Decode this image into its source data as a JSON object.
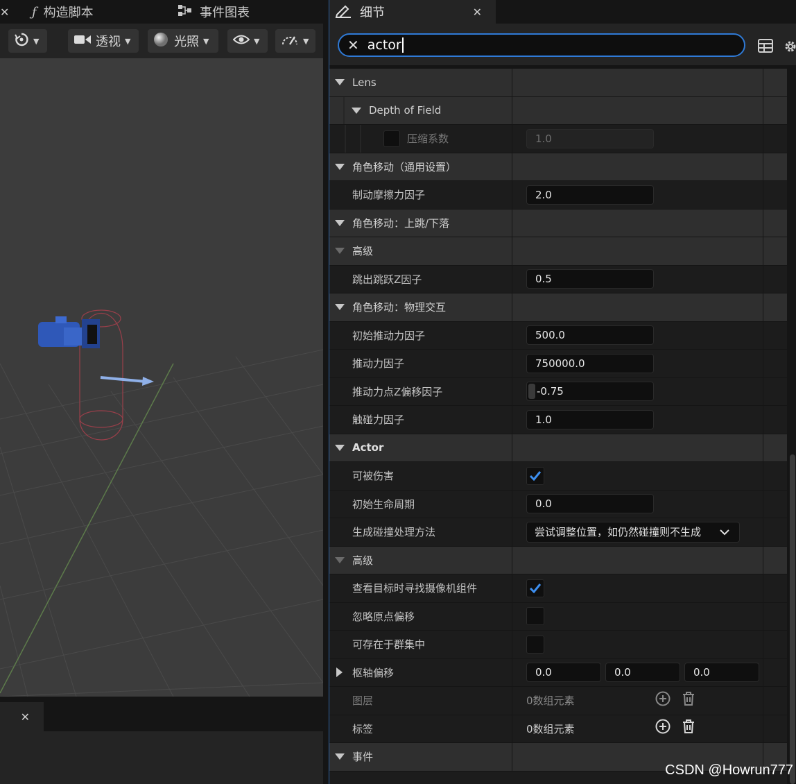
{
  "left_tabs": {
    "close": "✕",
    "construction_script_icon": "ƒ",
    "construction_script": "构造脚本",
    "event_graph": "事件图表"
  },
  "viewport_toolbar": {
    "view_mode": "透视",
    "lighting": "光照"
  },
  "bottom_tab": {
    "close": "✕"
  },
  "details": {
    "tab_title": "细节",
    "tab_close": "✕",
    "search_value": "actor",
    "rows": [
      {
        "kind": "cat",
        "label": "Lens"
      },
      {
        "kind": "cat",
        "label": "Depth of Field",
        "indent": 1
      },
      {
        "kind": "prop",
        "label": "压缩系数",
        "value": "1.0",
        "dim": true,
        "checkbox_prefix": true
      },
      {
        "kind": "cat",
        "label": "角色移动（通用设置）"
      },
      {
        "kind": "prop",
        "label": "制动摩擦力因子",
        "value": "2.0"
      },
      {
        "kind": "cat",
        "label": "角色移动：上跳/下落"
      },
      {
        "kind": "cat",
        "label": "高级",
        "dim_arrow": true
      },
      {
        "kind": "prop",
        "label": "跳出跳跃Z因子",
        "value": "0.5"
      },
      {
        "kind": "cat",
        "label": "角色移动：物理交互"
      },
      {
        "kind": "prop",
        "label": "初始推动力因子",
        "value": "500.0"
      },
      {
        "kind": "prop",
        "label": "推动力因子",
        "value": "750000.0"
      },
      {
        "kind": "prop",
        "label": "推动力点Z偏移因子",
        "value": "-0.75",
        "slider": true
      },
      {
        "kind": "prop",
        "label": "触碰力因子",
        "value": "1.0"
      },
      {
        "kind": "cat",
        "label": "Actor",
        "bold": true
      },
      {
        "kind": "check",
        "label": "可被伤害",
        "checked": true
      },
      {
        "kind": "prop",
        "label": "初始生命周期",
        "value": "0.0"
      },
      {
        "kind": "dropdown",
        "label": "生成碰撞处理方法",
        "value": "尝试调整位置，如仍然碰撞则不生成"
      },
      {
        "kind": "cat",
        "label": "高级",
        "dim_arrow": true
      },
      {
        "kind": "check",
        "label": "查看目标时寻找摄像机组件",
        "checked": true
      },
      {
        "kind": "check",
        "label": "忽略原点偏移",
        "checked": false
      },
      {
        "kind": "check",
        "label": "可存在于群集中",
        "checked": false
      },
      {
        "kind": "vector",
        "label": "枢轴偏移",
        "values": [
          "0.0",
          "0.0",
          "0.0"
        ]
      },
      {
        "kind": "array",
        "label": "图层",
        "value": "0数组元素",
        "dim": true
      },
      {
        "kind": "array",
        "label": "标签",
        "value": "0数组元素",
        "dim": false
      },
      {
        "kind": "cat",
        "label": "事件"
      }
    ]
  },
  "watermark": "CSDN @Howrun777",
  "colors": {
    "accent": "#2f7ad6",
    "checkmark": "#3d8ff0",
    "panel": "#242424",
    "row": "#1c1c1c",
    "category": "#2f2f2f"
  }
}
